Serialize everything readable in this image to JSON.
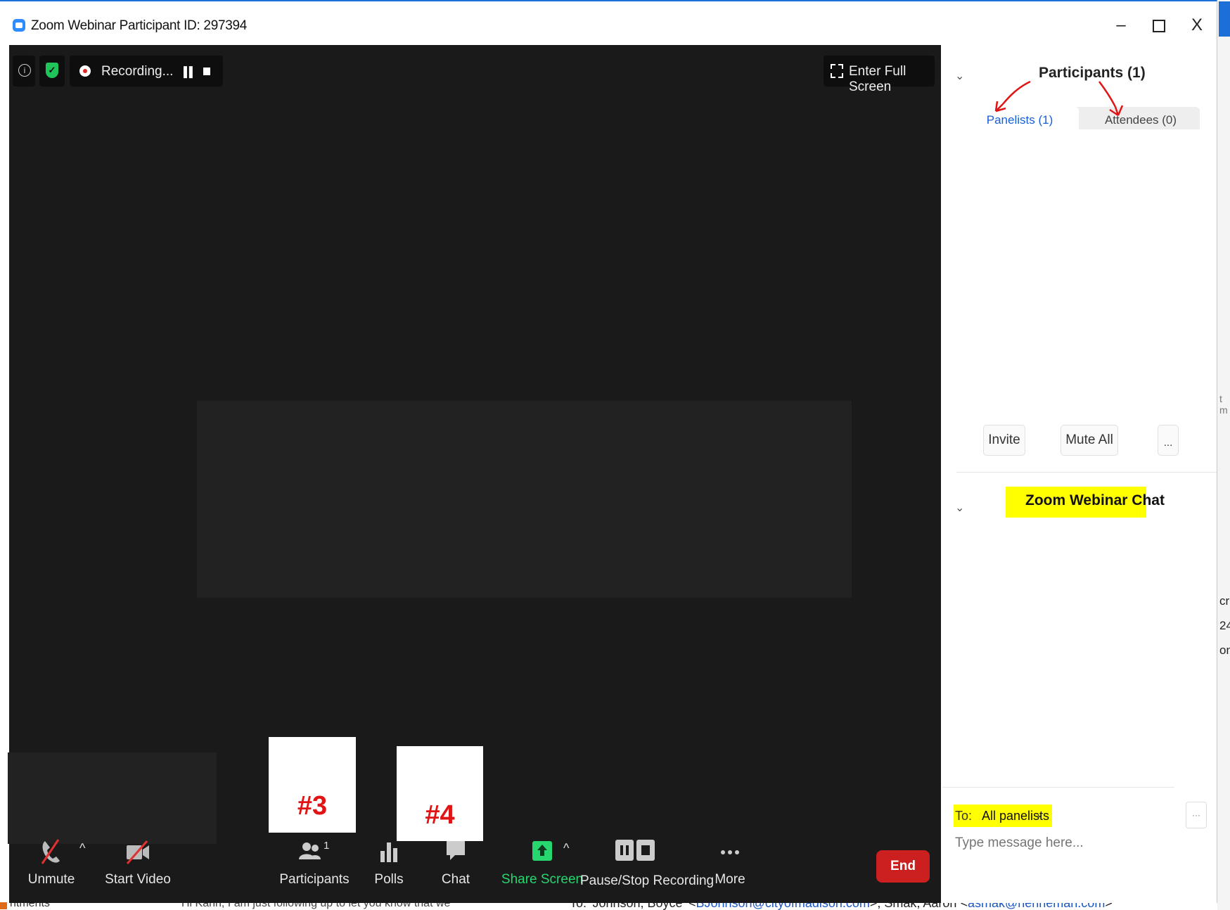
{
  "window": {
    "title": "Zoom Webinar Participant ID: 297394",
    "controls": {
      "minimize": "–",
      "close": "X"
    }
  },
  "top_bar": {
    "info_icon": "info-icon",
    "security_icon": "shield-check-icon",
    "recording_label": "Recording...",
    "fullscreen_label": "Enter Full Screen"
  },
  "annotations": {
    "box3_label": "#3",
    "box4_label": "#4"
  },
  "toolbar": {
    "unmute": "Unmute",
    "start_video": "Start Video",
    "participants": "Participants",
    "participants_count": "1",
    "polls": "Polls",
    "chat": "Chat",
    "share_screen": "Share Screen",
    "pause_stop_recording": "Pause/Stop Recording",
    "more": "More",
    "end": "End",
    "caret": "^"
  },
  "participants_panel": {
    "title": "Participants (1)",
    "tabs": [
      {
        "label": "Panelists (1)",
        "active": true
      },
      {
        "label": "Attendees (0)",
        "active": false
      }
    ],
    "buttons": {
      "invite": "Invite",
      "mute_all": "Mute All",
      "more": "..."
    }
  },
  "chat_panel": {
    "title": "Zoom Webinar Chat",
    "to_label": "To:",
    "to_value": "All panelists",
    "more": "···",
    "placeholder": "Type message here..."
  },
  "background_text": {
    "edge_1": "t m",
    "edge_2": "cr",
    "edge_3": "24",
    "edge_4": "on",
    "bottom_left": "ntments",
    "bottom_mid": "Hi Karin, I am just following up to let you know that we",
    "bottom_right_prefix": "To: 'Johnson, Boyce' <",
    "bottom_right_link1": "BJohnson@cityofmadison.com",
    "bottom_right_mid": ">; Smak, Aaron <",
    "bottom_right_link2": "asmak@henneman.com",
    "bottom_right_suffix": ">"
  },
  "colors": {
    "accent_blue": "#1560d6",
    "share_green": "#27d66f",
    "end_red": "#cc1f1f",
    "highlight_yellow": "#ffff00",
    "annotation_red": "#e01414"
  }
}
